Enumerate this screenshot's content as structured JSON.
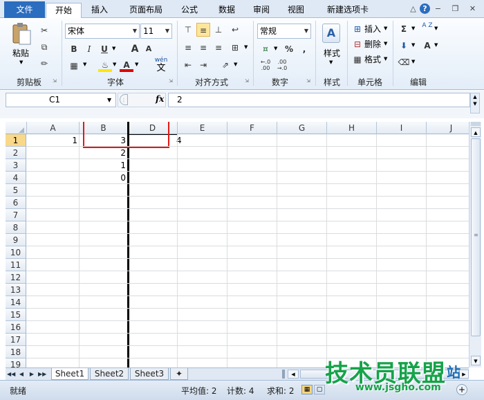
{
  "tabs": {
    "file": "文件",
    "items": [
      "开始",
      "插入",
      "页面布局",
      "公式",
      "数据",
      "审阅",
      "视图",
      "新建选项卡"
    ]
  },
  "window": {
    "help": "?",
    "minimize": "−",
    "restore": "❐",
    "close": "✕"
  },
  "clipboard": {
    "paste": "粘贴",
    "label": "剪贴板"
  },
  "font": {
    "name": "宋体",
    "size": "11",
    "bold": "B",
    "italic": "I",
    "underline": "U",
    "grow": "A",
    "shrink": "A",
    "font_color": "A",
    "wen": "wén",
    "wen_char": "文",
    "label": "字体"
  },
  "alignment": {
    "label": "对齐方式"
  },
  "number": {
    "format": "常规",
    "percent": "%",
    "comma": ",",
    "label": "数字"
  },
  "styles": {
    "label": "样式",
    "button": "样式"
  },
  "cells": {
    "insert": "插入",
    "delete": "删除",
    "format": "格式",
    "label": "单元格"
  },
  "editing": {
    "sum": "Σ",
    "sort": "A Z",
    "find": "A",
    "label": "编辑"
  },
  "formula_bar": {
    "name_box": "C1",
    "fx": "fx",
    "value": "2"
  },
  "columns": [
    "A",
    "B",
    "D",
    "E",
    "F",
    "G",
    "H",
    "I",
    "J"
  ],
  "rows": [
    "1",
    "2",
    "3",
    "4",
    "5",
    "6",
    "7",
    "8",
    "9",
    "10",
    "11",
    "12",
    "13",
    "14",
    "15",
    "16",
    "17",
    "18",
    "19"
  ],
  "cells_data": {
    "a1": "1",
    "b1": "3",
    "b2": "2",
    "b3": "1",
    "b4": "0",
    "e1": "4"
  },
  "sheets": [
    "Sheet1",
    "Sheet2",
    "Sheet3"
  ],
  "status": {
    "ready": "就绪",
    "average": "平均值: 2",
    "count": "计数: 4",
    "sum": "求和: 2"
  },
  "watermark": {
    "title": "技术员联盟",
    "subtitle": "www.jsgho.com",
    "site": "站"
  },
  "colors": {
    "file_tab": "#2b6dbf",
    "selected_row": "#f9d889",
    "highlight_box": "#e01818",
    "split_line": "#000000"
  }
}
